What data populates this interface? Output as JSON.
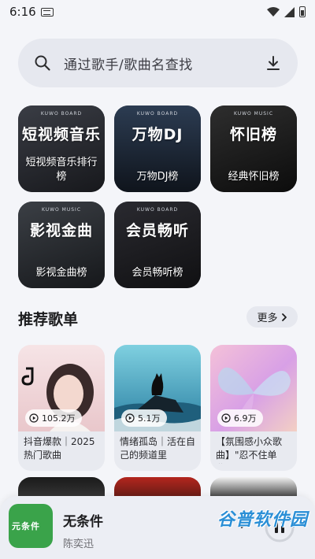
{
  "status_bar": {
    "time": "6:16"
  },
  "search": {
    "placeholder": "通过歌手/歌曲名查找"
  },
  "rank_lists": [
    {
      "label": "短视频音乐排行榜",
      "cover_text": "短视频音乐",
      "board": "KUWO BOARD",
      "accent": "#2b2e36"
    },
    {
      "label": "万物DJ榜",
      "cover_text": "万物DJ",
      "board": "KUWO BOARD",
      "accent": "#1b2a3a"
    },
    {
      "label": "经典怀旧榜",
      "cover_text": "怀旧榜",
      "board": "KUWO MUSIC",
      "accent": "#202020"
    },
    {
      "label": "影视金曲榜",
      "cover_text": "影视金曲",
      "board": "KUWO MUSIC",
      "accent": "#2c2f33"
    },
    {
      "label": "会员畅听榜",
      "cover_text": "会员畅听",
      "board": "KUWO BOARD",
      "accent": "#1e1e22"
    }
  ],
  "recommend": {
    "title": "推荐歌单",
    "more_label": "更多",
    "playlists": [
      {
        "title": "抖音爆款｜2025热门歌曲",
        "plays": "105.2万",
        "accent": "#f2d7d9"
      },
      {
        "title": "情绪孤岛｜活在自己的频道里",
        "plays": "5.1万",
        "accent": "#4fb0c6"
      },
      {
        "title": "【氛围感小众歌曲】\"忍不住单曲...",
        "plays": "6.9万",
        "accent": "#e9a6c7"
      }
    ]
  },
  "player": {
    "song_title": "无条件",
    "artist": "陈奕迅",
    "cover_text": "元条件"
  },
  "watermark": "谷普软件园"
}
